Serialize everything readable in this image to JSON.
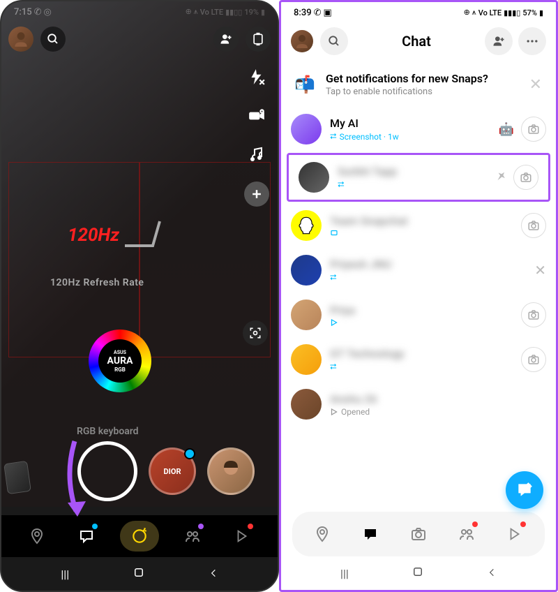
{
  "left": {
    "status": {
      "time": "7:15",
      "battery": "19%",
      "carrier": "Vo LTE"
    },
    "camera_text": {
      "hz": "120Hz",
      "refresh": "120Hz Refresh Rate",
      "aura_brand": "ASUS",
      "aura": "AURA",
      "aura_sub": "RGB",
      "keyboard": "RGB keyboard",
      "dior": "DIOR"
    }
  },
  "right": {
    "status": {
      "time": "8:39",
      "battery": "57%",
      "carrier": "Vo LTE"
    },
    "header": {
      "title": "Chat"
    },
    "notif": {
      "title": "Get notifications for new Snaps?",
      "sub": "Tap to enable notifications"
    },
    "chats": [
      {
        "name": "My AI",
        "status": "Screenshot · 1w",
        "icon": "screenshot"
      },
      {
        "name": "Surbhi Tapp",
        "status": "",
        "icon": "screenshot",
        "pinned": true,
        "highlighted": true
      },
      {
        "name": "Team Snapchat",
        "status": "",
        "icon": "chat"
      },
      {
        "name": "Priyesh JNU",
        "status": "",
        "icon": "screenshot",
        "dismissable": true
      },
      {
        "name": "Priya",
        "status": "",
        "icon": "opened"
      },
      {
        "name": "GT Technology",
        "status": "",
        "icon": "screenshot"
      },
      {
        "name": "Anshu 26",
        "status": "Opened",
        "icon": "opened"
      }
    ]
  }
}
